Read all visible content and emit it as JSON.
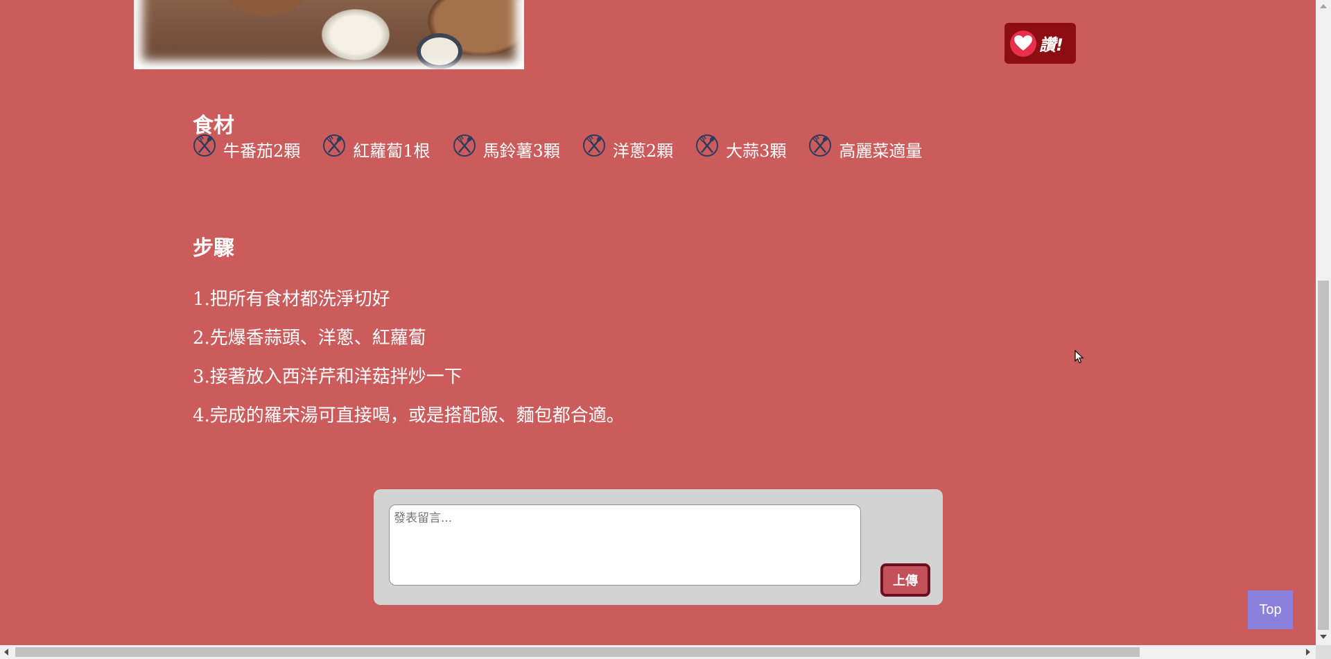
{
  "photo": {
    "alt": "food-photo"
  },
  "like_button": {
    "label": "讚!"
  },
  "ingredients": {
    "title": "食材",
    "items": [
      {
        "label": "牛番茄2顆"
      },
      {
        "label": "紅蘿蔔1根"
      },
      {
        "label": "馬鈴薯3顆"
      },
      {
        "label": "洋蔥2顆"
      },
      {
        "label": "大蒜3顆"
      },
      {
        "label": "高麗菜適量"
      }
    ],
    "icon": "utensils-icon"
  },
  "steps": {
    "title": "步驟",
    "items": [
      "1.把所有食材都洗淨切好",
      "2.先爆香蒜頭、洋蔥、紅蘿蔔",
      "3.接著放入西洋芹和洋菇拌炒一下",
      "4.完成的羅宋湯可直接喝，或是搭配飯、麵包都合適。"
    ]
  },
  "comment": {
    "placeholder": "發表留言...",
    "value": "",
    "submit_label": "上傳"
  },
  "top_button": {
    "label": "Top"
  },
  "colors": {
    "page_background": "#cc5c5c",
    "like_button": "#8d0d12",
    "heart": "#e8304c",
    "comment_panel": "#d3d3d3",
    "upload_button": "#c4515a",
    "top_button": "#8a7fda"
  }
}
